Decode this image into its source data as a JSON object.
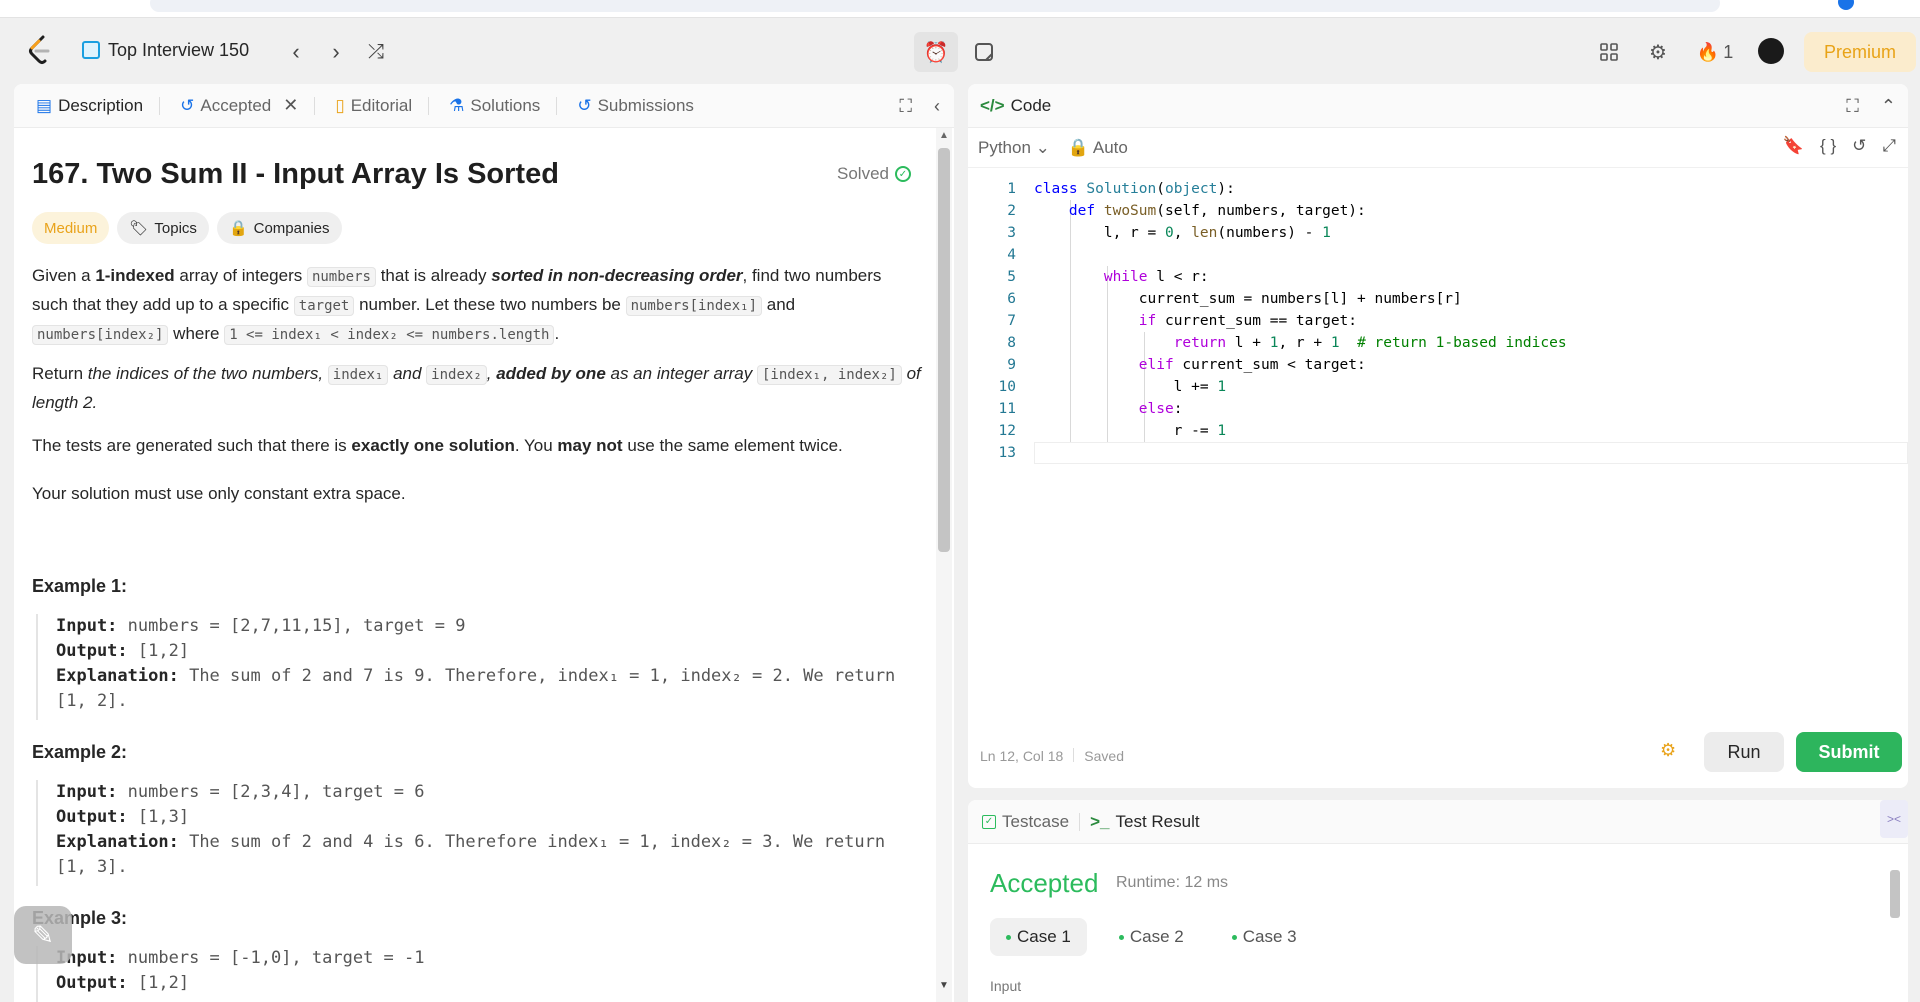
{
  "topbar": {
    "list_title": "Top Interview 150",
    "streak_count": "1",
    "premium_label": "Premium"
  },
  "left_tabs": {
    "description": "Description",
    "accepted": "Accepted",
    "editorial": "Editorial",
    "solutions": "Solutions",
    "submissions": "Submissions"
  },
  "problem": {
    "title": "167. Two Sum II - Input Array Is Sorted",
    "status": "Solved",
    "difficulty": "Medium",
    "topics_label": "Topics",
    "companies_label": "Companies",
    "p1": {
      "a": "Given a ",
      "b": "1-indexed",
      "c": " array of integers ",
      "d": "numbers",
      "e": " that is already ",
      "f": "sorted in non-decreasing order",
      "g": ", find two numbers such that they add up to a specific ",
      "h": "target",
      "i": " number. Let these two numbers be ",
      "j": "numbers[index₁]",
      "k": " and ",
      "l": "numbers[index₂]",
      "m": " where ",
      "n": "1 <= index₁ < index₂ <= numbers.length",
      "o": "."
    },
    "p2": {
      "a": "Return ",
      "b": "the indices of the two numbers, ",
      "c": "index₁",
      "d": " and ",
      "e": "index₂",
      "f": ", ",
      "g": "added by one",
      "h": " as an integer array ",
      "i": "[index₁, index₂]",
      "j": " of length 2."
    },
    "p3": {
      "a": "The tests are generated such that there is ",
      "b": "exactly one solution",
      "c": ". You ",
      "d": "may not",
      "e": " use the same element twice."
    },
    "p4": "Your solution must use only constant extra space.",
    "examples": [
      {
        "heading": "Example 1:",
        "input_label": "Input:",
        "input": "numbers = [2,7,11,15], target = 9",
        "output_label": "Output:",
        "output": "[1,2]",
        "expl_label": "Explanation:",
        "expl": "The sum of 2 and 7 is 9. Therefore, index₁ = 1, index₂ = 2. We return [1, 2]."
      },
      {
        "heading": "Example 2:",
        "input_label": "Input:",
        "input": "numbers = [2,3,4], target = 6",
        "output_label": "Output:",
        "output": "[1,3]",
        "expl_label": "Explanation:",
        "expl": "The sum of 2 and 4 is 6. Therefore index₁ = 1, index₂ = 3. We return [1, 3]."
      },
      {
        "heading": "Example 3:",
        "input_label": "Input:",
        "input": "numbers = [-1,0], target = -1",
        "output_label": "Output:",
        "output": "[1,2]"
      }
    ]
  },
  "code_panel": {
    "title": "Code",
    "language": "Python",
    "mode": "Auto",
    "lines": [
      {
        "n": "1",
        "text": "class Solution(object):"
      },
      {
        "n": "2",
        "text": "    def twoSum(self, numbers, target):"
      },
      {
        "n": "3",
        "text": "        l, r = 0, len(numbers) - 1"
      },
      {
        "n": "4",
        "text": ""
      },
      {
        "n": "5",
        "text": "        while l < r:"
      },
      {
        "n": "6",
        "text": "            current_sum = numbers[l] + numbers[r]"
      },
      {
        "n": "7",
        "text": "            if current_sum == target:"
      },
      {
        "n": "8",
        "text": "                return l + 1, r + 1  # return 1-based indices"
      },
      {
        "n": "9",
        "text": "            elif current_sum < target:"
      },
      {
        "n": "10",
        "text": "                l += 1"
      },
      {
        "n": "11",
        "text": "            else:"
      },
      {
        "n": "12",
        "text": "                r -= 1"
      },
      {
        "n": "13",
        "text": ""
      }
    ],
    "cursor_position": "Ln 12, Col 18",
    "save_state": "Saved",
    "run_label": "Run",
    "submit_label": "Submit"
  },
  "result_panel": {
    "testcase_tab": "Testcase",
    "result_tab": "Test Result",
    "verdict": "Accepted",
    "runtime": "Runtime: 12 ms",
    "cases": [
      "Case 1",
      "Case 2",
      "Case 3"
    ],
    "input_label": "Input"
  },
  "colors": {
    "accent_green": "#2cbb5d",
    "medium_orange": "#e9a31b",
    "premium_bg": "#fbeccd"
  }
}
